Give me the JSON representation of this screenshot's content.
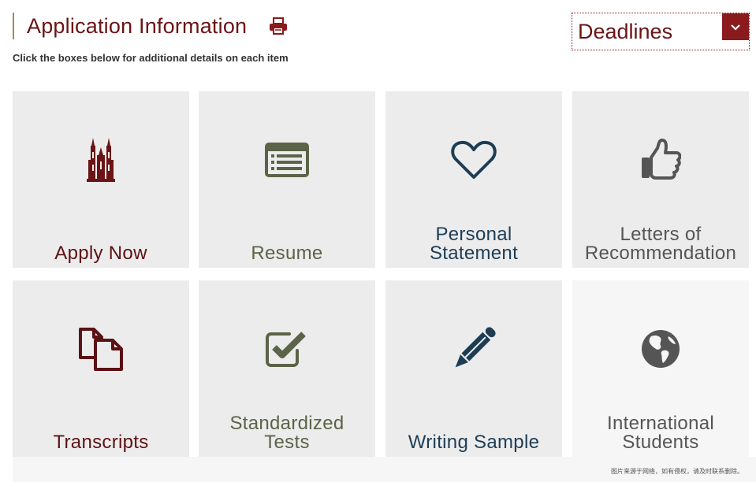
{
  "header": {
    "title": "Application Information",
    "subtitle": "Click the boxes below for additional details on each item"
  },
  "deadlines": {
    "label": "Deadlines"
  },
  "tiles": [
    {
      "label_lines": [
        "Apply Now"
      ],
      "icon": "cathedral-icon",
      "color": "#5c1214"
    },
    {
      "label_lines": [
        "Resume"
      ],
      "icon": "resume-icon",
      "color": "#5b6348"
    },
    {
      "label_lines": [
        "Personal",
        "Statement"
      ],
      "icon": "heart-icon",
      "color": "#1d3d55"
    },
    {
      "label_lines": [
        "Letters of",
        "Recommendation"
      ],
      "icon": "thumbs-up-icon",
      "color": "#555555"
    },
    {
      "label_lines": [
        "Transcripts"
      ],
      "icon": "copy-icon",
      "color": "#5c1214"
    },
    {
      "label_lines": [
        "Standardized",
        "Tests"
      ],
      "icon": "check-square-icon",
      "color": "#5b6348"
    },
    {
      "label_lines": [
        "Writing Sample"
      ],
      "icon": "pencil-icon",
      "color": "#1d3d55"
    },
    {
      "label_lines": [
        "International",
        "Students"
      ],
      "icon": "globe-icon",
      "color": "#555555"
    }
  ],
  "footer": {
    "note": "图片来源于网络，如有侵权，请及时联系删除。"
  }
}
